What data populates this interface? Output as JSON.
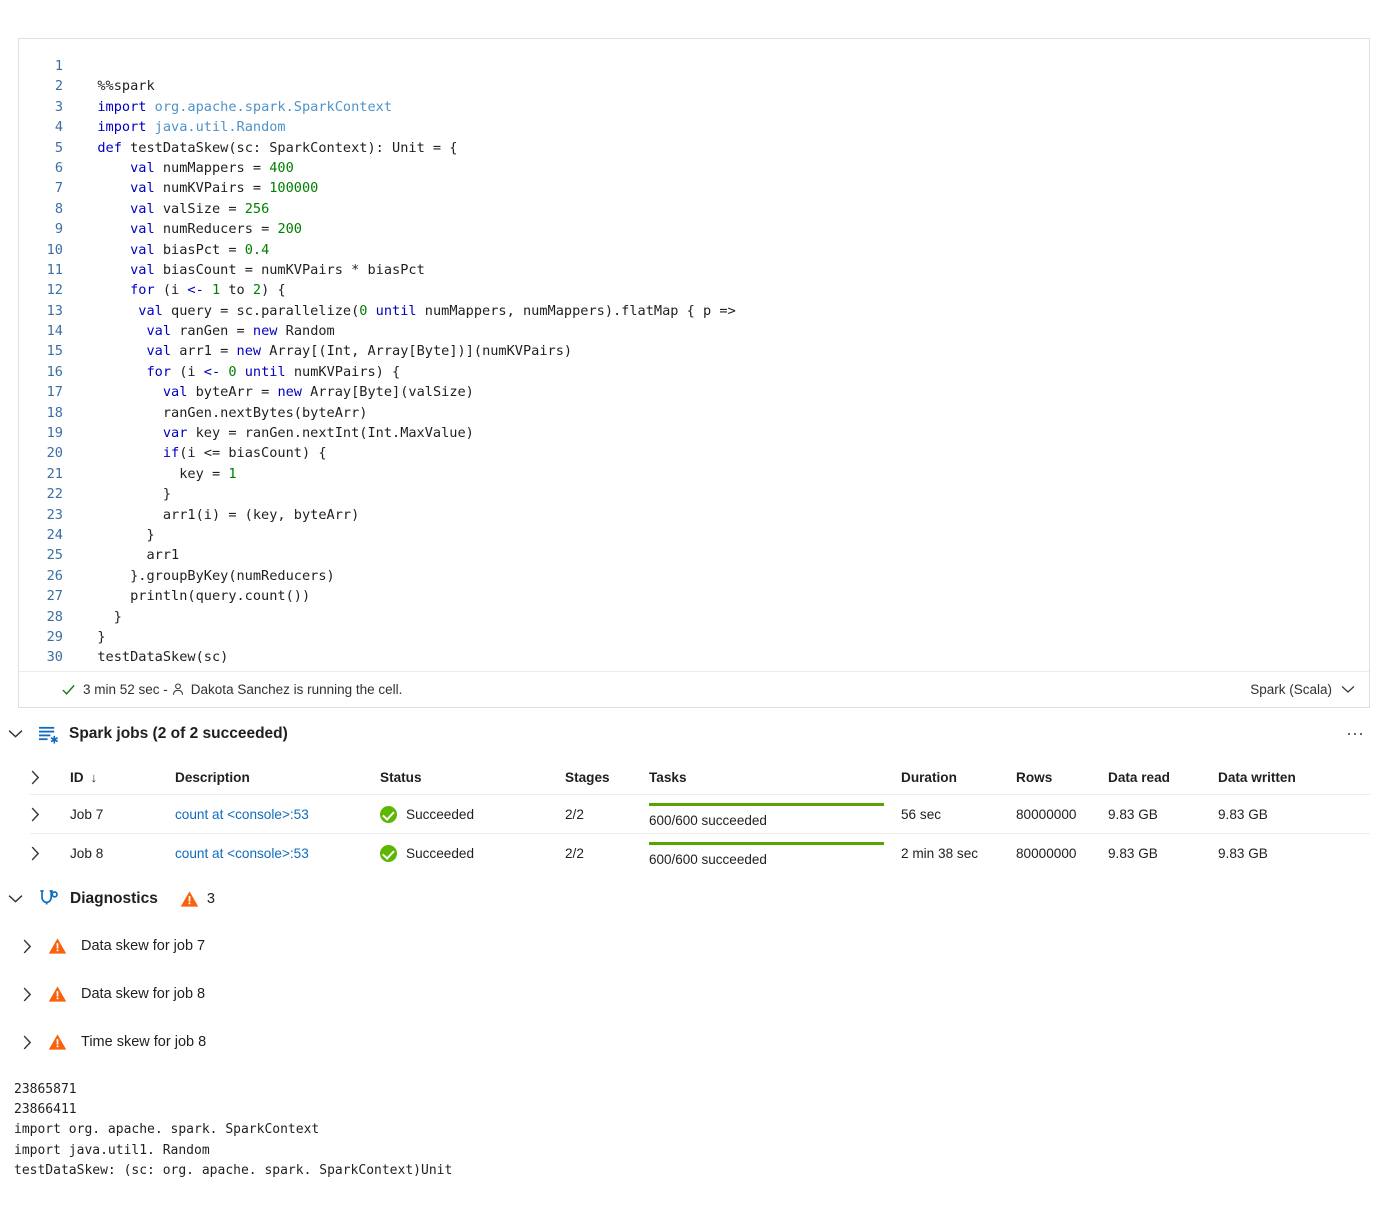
{
  "cell": {
    "language_label": "Spark (Scala)",
    "status": {
      "duration": "3 min 52 sec -",
      "user_message": "Dakota Sanchez is running the cell."
    },
    "code_lines": [
      {
        "n": "1",
        "tokens": []
      },
      {
        "n": "2",
        "tokens": [
          {
            "t": "src",
            "v": "  %%spark"
          }
        ]
      },
      {
        "n": "3",
        "tokens": [
          {
            "t": "src",
            "v": "  "
          },
          {
            "t": "kw",
            "v": "import"
          },
          {
            "t": "src",
            "v": " "
          },
          {
            "t": "ns",
            "v": "org.apache.spark.SparkContext"
          }
        ]
      },
      {
        "n": "4",
        "tokens": [
          {
            "t": "src",
            "v": "  "
          },
          {
            "t": "kw",
            "v": "import"
          },
          {
            "t": "src",
            "v": " "
          },
          {
            "t": "ns",
            "v": "java.util.Random"
          }
        ]
      },
      {
        "n": "5",
        "tokens": [
          {
            "t": "src",
            "v": "  "
          },
          {
            "t": "kw",
            "v": "def"
          },
          {
            "t": "src",
            "v": " testDataSkew(sc: SparkContext): Unit = {"
          }
        ]
      },
      {
        "n": "6",
        "tokens": [
          {
            "t": "src",
            "v": "      "
          },
          {
            "t": "kw",
            "v": "val"
          },
          {
            "t": "src",
            "v": " numMappers = "
          },
          {
            "t": "num",
            "v": "400"
          }
        ]
      },
      {
        "n": "7",
        "tokens": [
          {
            "t": "src",
            "v": "      "
          },
          {
            "t": "kw",
            "v": "val"
          },
          {
            "t": "src",
            "v": " numKVPairs = "
          },
          {
            "t": "num",
            "v": "100000"
          }
        ]
      },
      {
        "n": "8",
        "tokens": [
          {
            "t": "src",
            "v": "      "
          },
          {
            "t": "kw",
            "v": "val"
          },
          {
            "t": "src",
            "v": " valSize = "
          },
          {
            "t": "num",
            "v": "256"
          }
        ]
      },
      {
        "n": "9",
        "tokens": [
          {
            "t": "src",
            "v": "      "
          },
          {
            "t": "kw",
            "v": "val"
          },
          {
            "t": "src",
            "v": " numReducers = "
          },
          {
            "t": "num",
            "v": "200"
          }
        ]
      },
      {
        "n": "10",
        "tokens": [
          {
            "t": "src",
            "v": "      "
          },
          {
            "t": "kw",
            "v": "val"
          },
          {
            "t": "src",
            "v": " biasPct = "
          },
          {
            "t": "num",
            "v": "0.4"
          }
        ]
      },
      {
        "n": "11",
        "tokens": [
          {
            "t": "src",
            "v": "      "
          },
          {
            "t": "kw",
            "v": "val"
          },
          {
            "t": "src",
            "v": " biasCount = numKVPairs * biasPct"
          }
        ]
      },
      {
        "n": "12",
        "tokens": [
          {
            "t": "src",
            "v": "      "
          },
          {
            "t": "kw",
            "v": "for"
          },
          {
            "t": "src",
            "v": " (i "
          },
          {
            "t": "kw",
            "v": "<-"
          },
          {
            "t": "src",
            "v": " "
          },
          {
            "t": "num",
            "v": "1"
          },
          {
            "t": "src",
            "v": " to "
          },
          {
            "t": "num",
            "v": "2"
          },
          {
            "t": "src",
            "v": ") {"
          }
        ]
      },
      {
        "n": "13",
        "tokens": [
          {
            "t": "src",
            "v": "       "
          },
          {
            "t": "kw",
            "v": "val"
          },
          {
            "t": "src",
            "v": " query = sc.parallelize("
          },
          {
            "t": "num",
            "v": "0"
          },
          {
            "t": "src",
            "v": " "
          },
          {
            "t": "kw",
            "v": "until"
          },
          {
            "t": "src",
            "v": " numMappers, numMappers).flatMap { p =>"
          }
        ]
      },
      {
        "n": "14",
        "tokens": [
          {
            "t": "src",
            "v": "        "
          },
          {
            "t": "kw",
            "v": "val"
          },
          {
            "t": "src",
            "v": " ranGen = "
          },
          {
            "t": "kw",
            "v": "new"
          },
          {
            "t": "src",
            "v": " Random"
          }
        ]
      },
      {
        "n": "15",
        "tokens": [
          {
            "t": "src",
            "v": "        "
          },
          {
            "t": "kw",
            "v": "val"
          },
          {
            "t": "src",
            "v": " arr1 = "
          },
          {
            "t": "kw",
            "v": "new"
          },
          {
            "t": "src",
            "v": " Array[(Int, Array[Byte])](numKVPairs)"
          }
        ]
      },
      {
        "n": "16",
        "tokens": [
          {
            "t": "src",
            "v": "        "
          },
          {
            "t": "kw",
            "v": "for"
          },
          {
            "t": "src",
            "v": " (i "
          },
          {
            "t": "kw",
            "v": "<-"
          },
          {
            "t": "src",
            "v": " "
          },
          {
            "t": "num",
            "v": "0"
          },
          {
            "t": "src",
            "v": " "
          },
          {
            "t": "kw",
            "v": "until"
          },
          {
            "t": "src",
            "v": " numKVPairs) {"
          }
        ]
      },
      {
        "n": "17",
        "tokens": [
          {
            "t": "src",
            "v": "          "
          },
          {
            "t": "kw",
            "v": "val"
          },
          {
            "t": "src",
            "v": " byteArr = "
          },
          {
            "t": "kw",
            "v": "new"
          },
          {
            "t": "src",
            "v": " Array[Byte](valSize)"
          }
        ]
      },
      {
        "n": "18",
        "tokens": [
          {
            "t": "src",
            "v": "          ranGen.nextBytes(byteArr)"
          }
        ]
      },
      {
        "n": "19",
        "tokens": [
          {
            "t": "src",
            "v": "          "
          },
          {
            "t": "kw",
            "v": "var"
          },
          {
            "t": "src",
            "v": " key = ranGen.nextInt(Int.MaxValue)"
          }
        ]
      },
      {
        "n": "20",
        "tokens": [
          {
            "t": "src",
            "v": "          "
          },
          {
            "t": "kw",
            "v": "if"
          },
          {
            "t": "src",
            "v": "(i <= biasCount) {"
          }
        ]
      },
      {
        "n": "21",
        "tokens": [
          {
            "t": "src",
            "v": "            key = "
          },
          {
            "t": "num",
            "v": "1"
          }
        ]
      },
      {
        "n": "22",
        "tokens": [
          {
            "t": "src",
            "v": "          }"
          }
        ]
      },
      {
        "n": "23",
        "tokens": [
          {
            "t": "src",
            "v": "          arr1(i) = (key, byteArr)"
          }
        ]
      },
      {
        "n": "24",
        "tokens": [
          {
            "t": "src",
            "v": "        }"
          }
        ]
      },
      {
        "n": "25",
        "tokens": [
          {
            "t": "src",
            "v": "        arr1"
          }
        ]
      },
      {
        "n": "26",
        "tokens": [
          {
            "t": "src",
            "v": "      }.groupByKey(numReducers)"
          }
        ]
      },
      {
        "n": "27",
        "tokens": [
          {
            "t": "src",
            "v": "      println(query.count())"
          }
        ]
      },
      {
        "n": "28",
        "tokens": [
          {
            "t": "src",
            "v": "    }"
          }
        ]
      },
      {
        "n": "29",
        "tokens": [
          {
            "t": "src",
            "v": "  }"
          }
        ]
      },
      {
        "n": "30",
        "tokens": [
          {
            "t": "src",
            "v": "  testDataSkew(sc)"
          }
        ]
      }
    ]
  },
  "spark_jobs": {
    "title": "Spark jobs (2 of 2 succeeded)",
    "columns": {
      "id": "ID",
      "description": "Description",
      "status": "Status",
      "stages": "Stages",
      "tasks": "Tasks",
      "duration": "Duration",
      "rows": "Rows",
      "data_read": "Data read",
      "data_written": "Data written"
    },
    "sort_arrow": "↓",
    "rows": [
      {
        "id": "Job 7",
        "description": "count at <console>:53",
        "status": "Succeeded",
        "stages": "2/2",
        "tasks": "600/600 succeeded",
        "tasks_percent": 100,
        "duration": "56 sec",
        "rows": "80000000",
        "data_read": "9.83 GB",
        "data_written": "9.83 GB"
      },
      {
        "id": "Job 8",
        "description": "count at <console>:53",
        "status": "Succeeded",
        "stages": "2/2",
        "tasks": "600/600 succeeded",
        "tasks_percent": 100,
        "duration": "2 min 38 sec",
        "rows": "80000000",
        "data_read": "9.83 GB",
        "data_written": "9.83 GB"
      }
    ]
  },
  "diagnostics": {
    "title": "Diagnostics",
    "warning_count": "3",
    "items": [
      {
        "label": "Data skew for job 7"
      },
      {
        "label": "Data skew for job 8"
      },
      {
        "label": "Time skew for job 8"
      }
    ]
  },
  "console_output": "23865871\n23866411\nimport org. apache. spark. SparkContext\nimport java.util1. Random\ntestDataSkew: (sc: org. apache. spark. SparkContext)Unit",
  "colors": {
    "link": "#0f6cbd",
    "success_green": "#5bb700",
    "bar_green": "#57a300",
    "warning_orange": "#f7630c",
    "icon_blue": "#0f6cbd",
    "keyword_blue": "#0000c0",
    "namespace_blue": "#4f93c9",
    "number_green": "#008000"
  }
}
